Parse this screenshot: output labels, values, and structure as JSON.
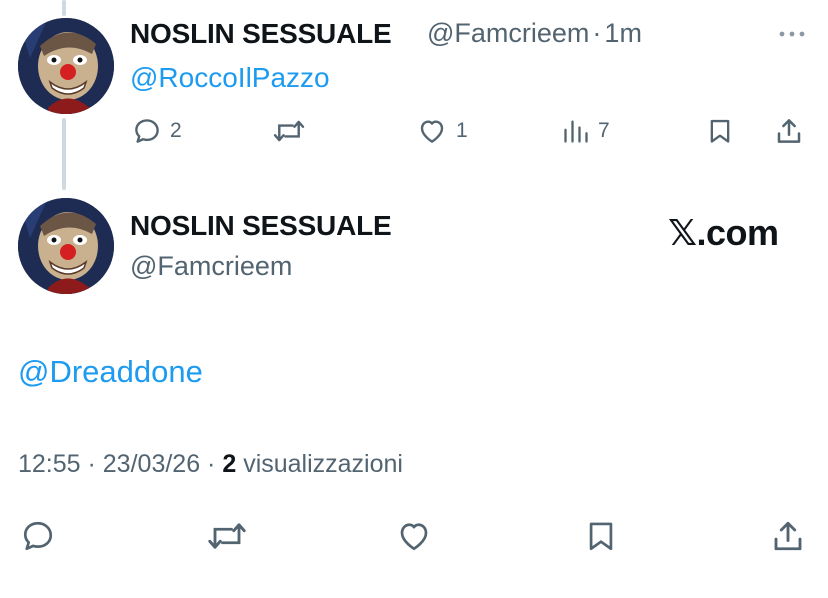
{
  "reply": {
    "author_name": "NOSLIN SESSUALE",
    "author_handle": "@Famcrieem",
    "separator": "·",
    "time_ago": "1m",
    "text": "@RoccoIlPazzo",
    "more_icon": "more-dots-icon",
    "actions": {
      "reply_count": "2",
      "like_count": "1",
      "views_count": "7"
    }
  },
  "main": {
    "author_name": "NOSLIN SESSUALE",
    "author_handle": "@Famcrieem",
    "watermark_brand": "𝕏",
    "watermark_domain": ".com",
    "text": "@Dreaddone",
    "time": "12:55",
    "dot1": " · ",
    "date": "23/03/26",
    "dot2": " · ",
    "views_number": "2",
    "views_label": "visualizzazioni"
  },
  "colors": {
    "link": "#1d9bf0",
    "muted": "#536471",
    "text": "#0f1419",
    "thread_line": "#cfd9de"
  }
}
